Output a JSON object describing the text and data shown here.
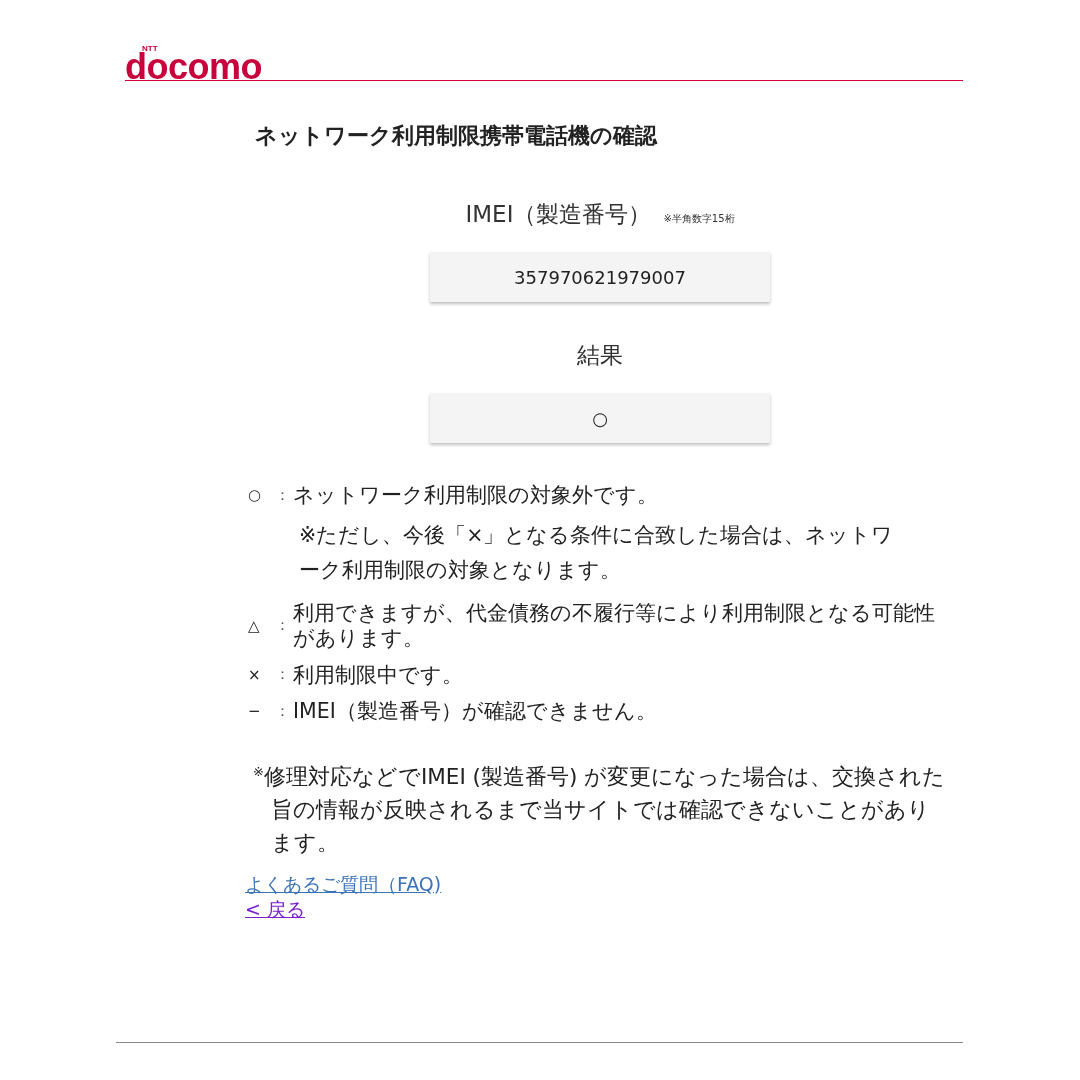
{
  "logo": {
    "small": "NTT",
    "main": "docomo"
  },
  "title": "ネットワーク利用制限携帯電話機の確認",
  "imei": {
    "label": "IMEI（製造番号）",
    "hint": "※半角数字15桁",
    "value": "357970621979007"
  },
  "result": {
    "label": "結果",
    "value": "○"
  },
  "legend": [
    {
      "symbol": "○",
      "sep": "：",
      "text": "ネットワーク利用制限の対象外です。",
      "note": "※ただし、今後「×」となる条件に合致した場合は、ネットワーク利用制限の対象となります。"
    },
    {
      "symbol": "△",
      "sep": "：",
      "text": "利用できますが、代金債務の不履行等により利用制限となる可能性があります。"
    },
    {
      "symbol": "×",
      "sep": "：",
      "text": "利用制限中です。"
    },
    {
      "symbol": "−",
      "sep": "：",
      "text": "IMEI（製造番号）が確認できません。"
    }
  ],
  "notice": "$^{※}$修理対応などでIMEI (製造番号) が変更になった場合は、交換された旨の情報が反映されるまで当サイトでは確認できないことがあります。",
  "links": [
    {
      "label": "よくあるご質問（FAQ)",
      "visited": false
    },
    {
      "label": "< 戻る",
      "visited": true
    }
  ]
}
